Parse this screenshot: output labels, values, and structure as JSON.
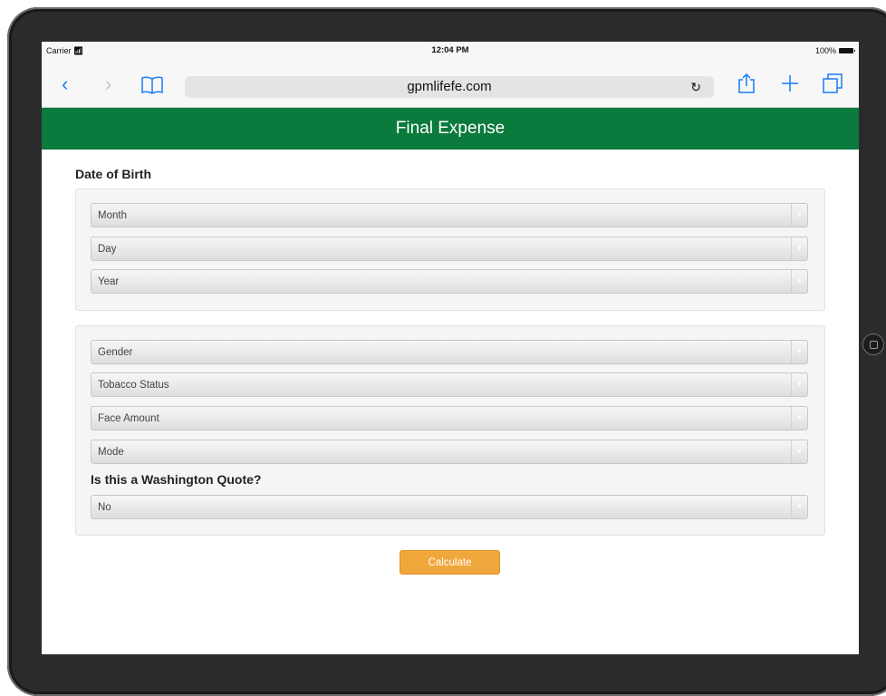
{
  "status_bar": {
    "carrier": "Carrier",
    "time": "12:04 PM",
    "battery": "100%"
  },
  "browser": {
    "url": "gpmlifefe.com",
    "icons": [
      "back-chevron",
      "forward-chevron",
      "bookmarks-book",
      "reload",
      "share",
      "new-tab-plus",
      "tabs"
    ]
  },
  "header": {
    "title": "Final Expense"
  },
  "dob": {
    "heading": "Date of Birth",
    "month": "Month",
    "day": "Day",
    "year": "Year"
  },
  "details": {
    "gender": "Gender",
    "tobacco": "Tobacco Status",
    "face_amount": "Face Amount",
    "mode": "Mode",
    "washington_label": "Is this a Washington Quote?",
    "washington_value": "No"
  },
  "actions": {
    "calculate": "Calculate"
  },
  "colors": {
    "header_bg": "#0a7a3d",
    "button_bg": "#f0a73b",
    "link_blue": "#1a7cf5"
  }
}
